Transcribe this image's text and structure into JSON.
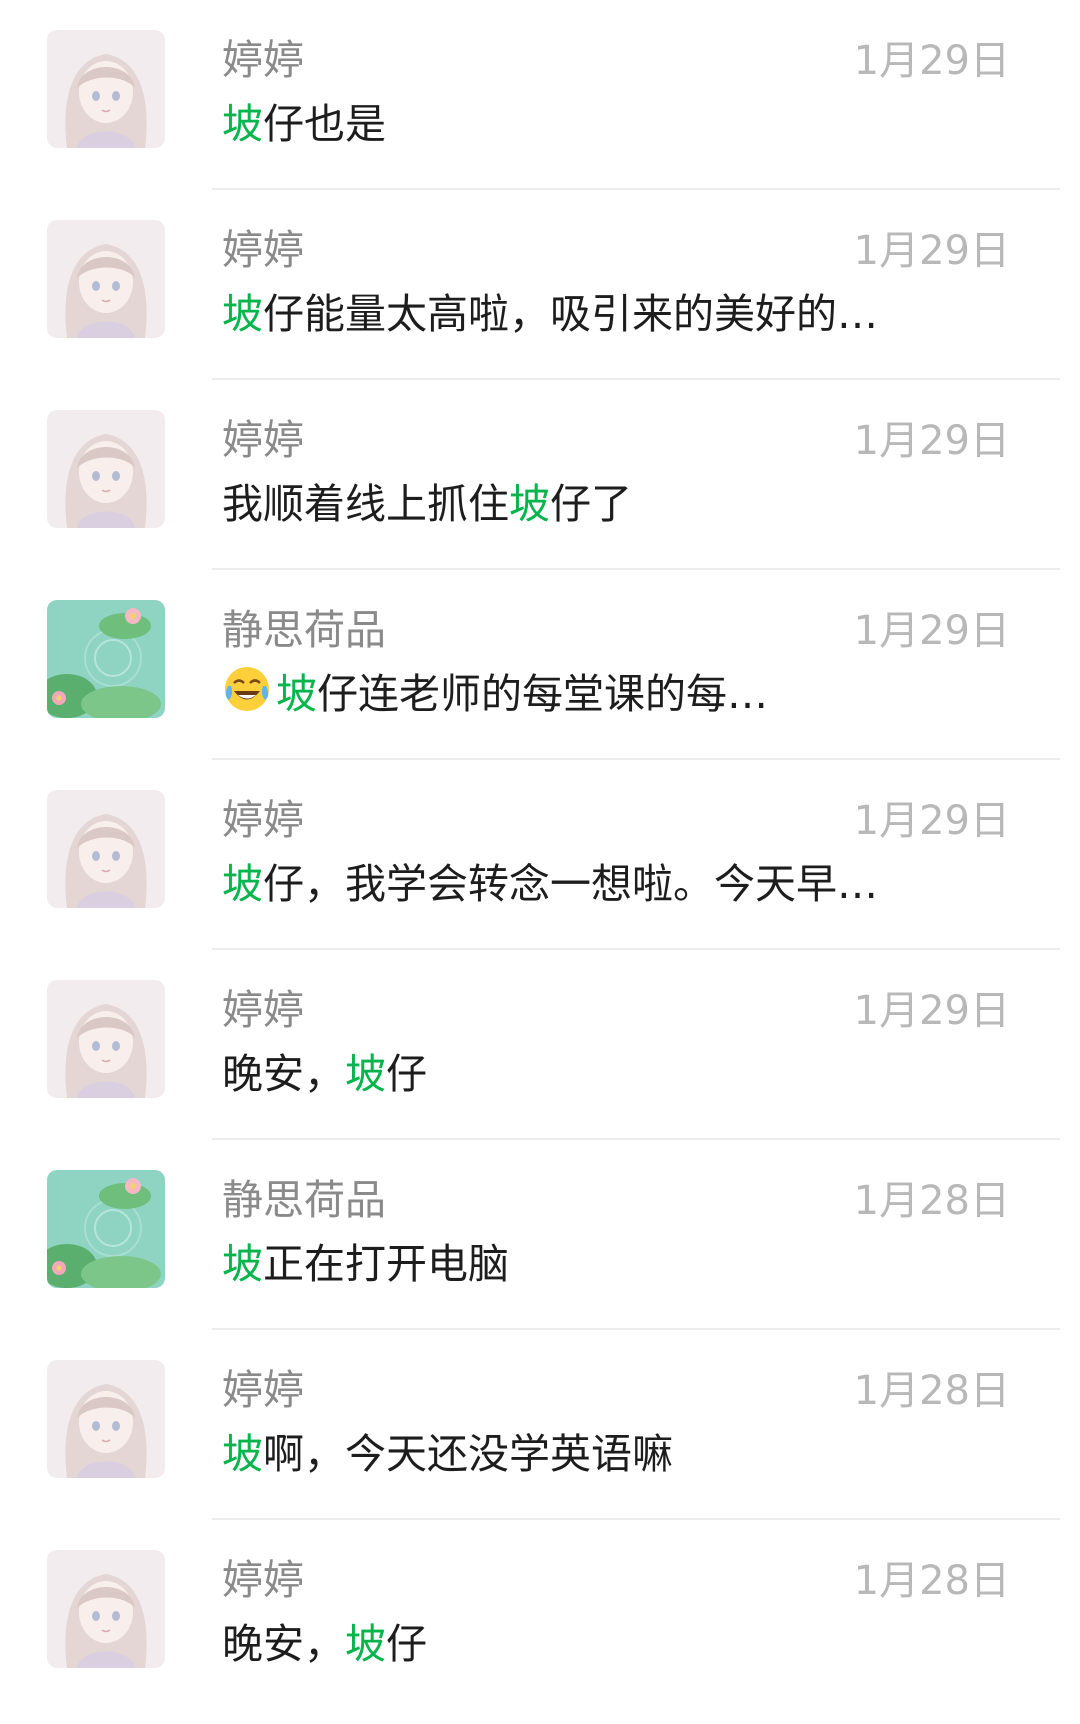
{
  "messages": [
    {
      "sender": "婷婷",
      "date": "1月29日",
      "avatar_icon": "anime-girl-avatar",
      "pre": "",
      "hl": "坡",
      "post": "仔也是"
    },
    {
      "sender": "婷婷",
      "date": "1月29日",
      "avatar_icon": "anime-girl-avatar",
      "pre": "",
      "hl": "坡",
      "post": "仔能量太高啦，吸引来的美好的…"
    },
    {
      "sender": "婷婷",
      "date": "1月29日",
      "avatar_icon": "anime-girl-avatar",
      "pre": "我顺着线上抓住",
      "hl": "坡",
      "post": "仔了"
    },
    {
      "sender": "静思荷品",
      "date": "1月29日",
      "avatar_icon": "lotus-pond-avatar",
      "emoji": "tears-of-joy-emoji",
      "pre": "",
      "hl": "坡",
      "post": "仔连老师的每堂课的每…"
    },
    {
      "sender": "婷婷",
      "date": "1月29日",
      "avatar_icon": "anime-girl-avatar",
      "pre": "",
      "hl": "坡",
      "post": "仔，我学会转念一想啦。今天早…"
    },
    {
      "sender": "婷婷",
      "date": "1月29日",
      "avatar_icon": "anime-girl-avatar",
      "pre": "晚安，",
      "hl": "坡",
      "post": "仔"
    },
    {
      "sender": "静思荷品",
      "date": "1月28日",
      "avatar_icon": "lotus-pond-avatar",
      "pre": "",
      "hl": "坡",
      "post": "正在打开电脑"
    },
    {
      "sender": "婷婷",
      "date": "1月28日",
      "avatar_icon": "anime-girl-avatar",
      "pre": "",
      "hl": "坡",
      "post": "啊，今天还没学英语嘛"
    },
    {
      "sender": "婷婷",
      "date": "1月28日",
      "avatar_icon": "anime-girl-avatar",
      "pre": "晚安，",
      "hl": "坡",
      "post": "仔"
    }
  ],
  "colors": {
    "highlight": "#07b54c",
    "sender_text": "#8a8a8a",
    "date_text": "#b8b8b8",
    "snippet_text": "#1d1d1d",
    "divider": "#ededed"
  }
}
